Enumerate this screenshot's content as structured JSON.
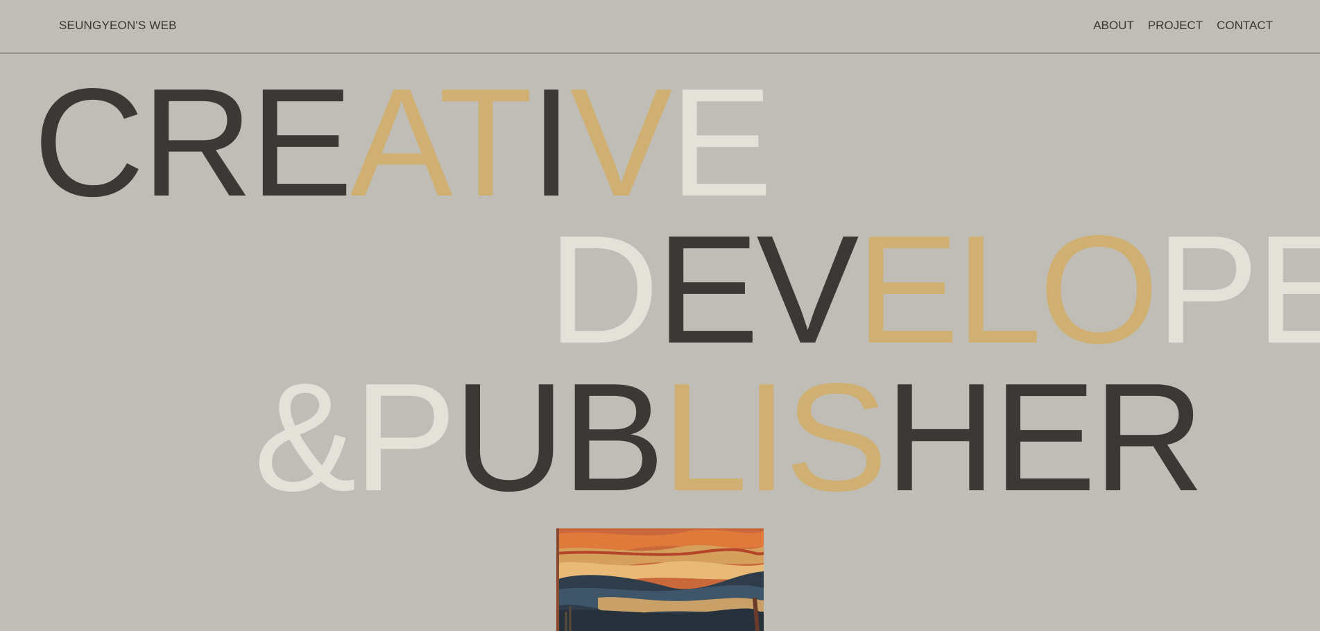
{
  "header": {
    "logo": "SEUNGYEON'S WEB",
    "nav": [
      "ABOUT",
      "PROJECT",
      "CONTACT"
    ]
  },
  "hero": {
    "lines": [
      [
        {
          "text": "CRE",
          "color": "#3b3935"
        },
        {
          "text": "AT",
          "color": "#cfb072"
        },
        {
          "text": "I",
          "color": "#3b3935"
        },
        {
          "text": "V",
          "color": "#cfb072"
        },
        {
          "text": "E",
          "color": "#e3e2d9"
        }
      ],
      [
        {
          "text": "D",
          "color": "#e3e2d9"
        },
        {
          "text": "EV",
          "color": "#3b3935"
        },
        {
          "text": "ELO",
          "color": "#cfb072"
        },
        {
          "text": "PER",
          "color": "#e3e2d9"
        }
      ],
      [
        {
          "text": "&P",
          "color": "#e3e2d9"
        },
        {
          "text": "UB",
          "color": "#3b3935"
        },
        {
          "text": "LIS",
          "color": "#cfb072"
        },
        {
          "text": "HER",
          "color": "#3b3935"
        }
      ]
    ]
  },
  "colors": {
    "background": "#bfbdb5",
    "dark": "#3b3935",
    "gold": "#cfb072",
    "light": "#e3e2d9"
  },
  "artwork": {
    "name": "the-scream-painting"
  }
}
